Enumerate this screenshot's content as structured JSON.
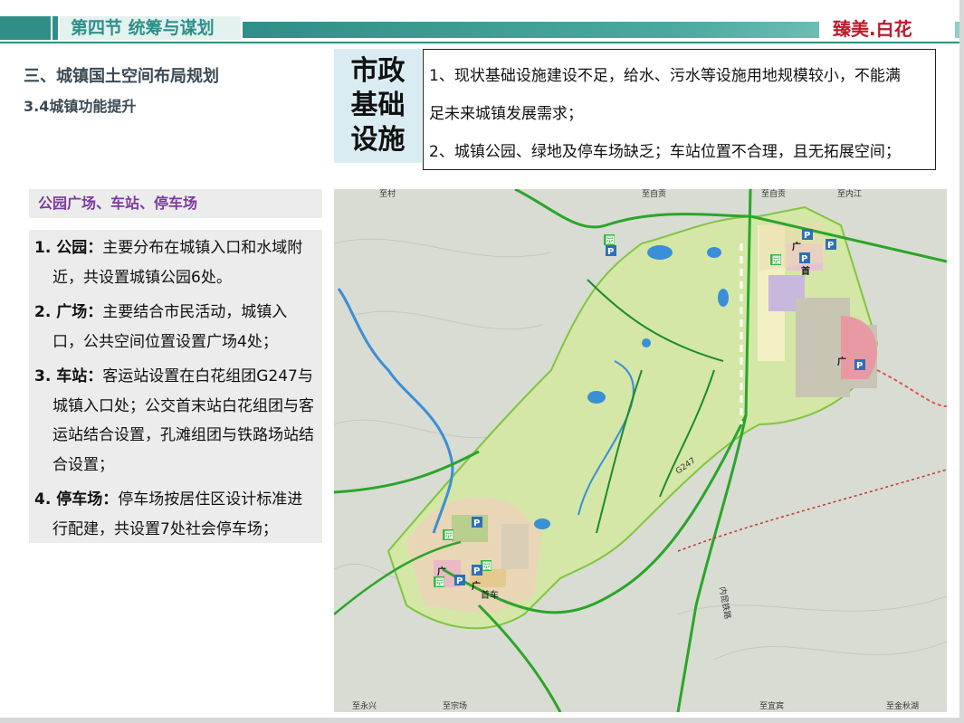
{
  "header": {
    "title": "第四节 统筹与谋划",
    "brand": "臻美.白花"
  },
  "section": {
    "title": "三、城镇国土空间布局规划",
    "subtitle": "3.4城镇功能提升"
  },
  "infrastructure": {
    "label": "市政\n基础\n设施",
    "lines": [
      "1、现状基础设施建设不足，给水、污水等设施用地规模较小，不能满",
      "足未来城镇发展需求；",
      "2、城镇公园、绿地及停车场缺乏；车站位置不合理，且无拓展空间；"
    ]
  },
  "panel": {
    "title": "公园广场、车站、停车场",
    "items": [
      {
        "head": "1. 公园：",
        "text": "主要分布在城镇入口和水域附近，共设置城镇公园6处。"
      },
      {
        "head": "2. 广场：",
        "text": "主要结合市民活动，城镇入口，公共空间位置设置广场4处；"
      },
      {
        "head": "3. 车站：",
        "text": "客运站设置在白花组团G247与城镇入口处；公交首末站白花组团与客运站结合设置，孔滩组团与铁路场站结合设置；"
      },
      {
        "head": "4. 停车场：",
        "text": "停车场按居住区设计标准进行配建，共设置7处社会停车场；"
      }
    ]
  },
  "map": {
    "labels": {
      "top1": "至村",
      "top2": "至自贡",
      "top3": "至自贡",
      "top4": "至内江",
      "road": "G247",
      "rail": "内昆铁路",
      "bottom1": "至永兴",
      "bottom2": "至宗场",
      "bottom3": "至宜宾",
      "bottom4": "至金秋湖"
    },
    "markers": {
      "park": "园",
      "plaza": "广",
      "parking": "P",
      "terminal": "首",
      "terminal_full": "首车"
    }
  }
}
